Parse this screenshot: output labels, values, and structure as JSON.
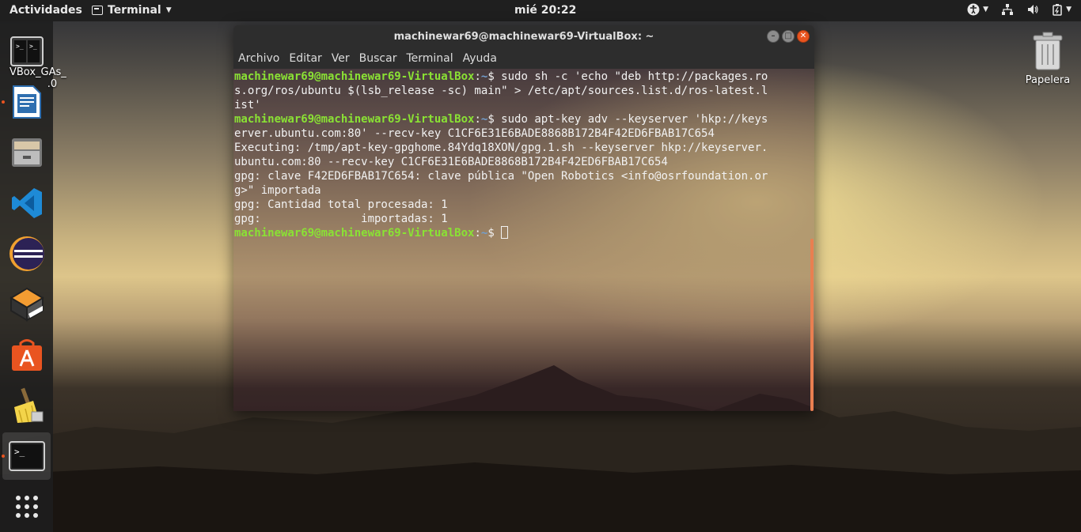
{
  "topbar": {
    "activities": "Actividades",
    "app_menu": "Terminal",
    "clock": "mié 20:22"
  },
  "desktop": {
    "vbox_label_1": "VBox_G",
    "vbox_label_2": "As_",
    "vbox_label_3": ".0",
    "trash_label": "Papelera"
  },
  "dock": {
    "items": [
      "terminal-vbox",
      "libreoffice-writer",
      "files",
      "vscode",
      "eclipse",
      "virtualbox",
      "software-center",
      "bleachbit",
      "terminal",
      "show-applications"
    ]
  },
  "window": {
    "title": "machinewar69@machinewar69-VirtualBox: ~",
    "menu": [
      "Archivo",
      "Editar",
      "Ver",
      "Buscar",
      "Terminal",
      "Ayuda"
    ]
  },
  "terminal": {
    "prompt_user": "machinewar69@machinewar69-VirtualBox",
    "prompt_sep": ":",
    "prompt_path": "~",
    "prompt_dollar": "$ ",
    "cmd1_l1": "sudo sh -c 'echo \"deb http://packages.ro",
    "cmd1_l2": "s.org/ros/ubuntu $(lsb_release -sc) main\" > /etc/apt/sources.list.d/ros-latest.l",
    "cmd1_l3": "ist'",
    "cmd2_l1": "sudo apt-key adv --keyserver 'hkp://keys",
    "cmd2_l2": "erver.ubuntu.com:80' --recv-key C1CF6E31E6BADE8868B172B4F42ED6FBAB17C654",
    "out1": "Executing: /tmp/apt-key-gpghome.84Ydq18XON/gpg.1.sh --keyserver hkp://keyserver.",
    "out2": "ubuntu.com:80 --recv-key C1CF6E31E6BADE8868B172B4F42ED6FBAB17C654",
    "out3": "gpg: clave F42ED6FBAB17C654: clave pública \"Open Robotics <info@osrfoundation.or",
    "out4": "g>\" importada",
    "out5": "gpg: Cantidad total procesada: 1",
    "out6": "gpg:               importadas: 1"
  },
  "colors": {
    "accent": "#e95420",
    "prompt_user": "#8ae234",
    "prompt_path": "#729fcf"
  }
}
